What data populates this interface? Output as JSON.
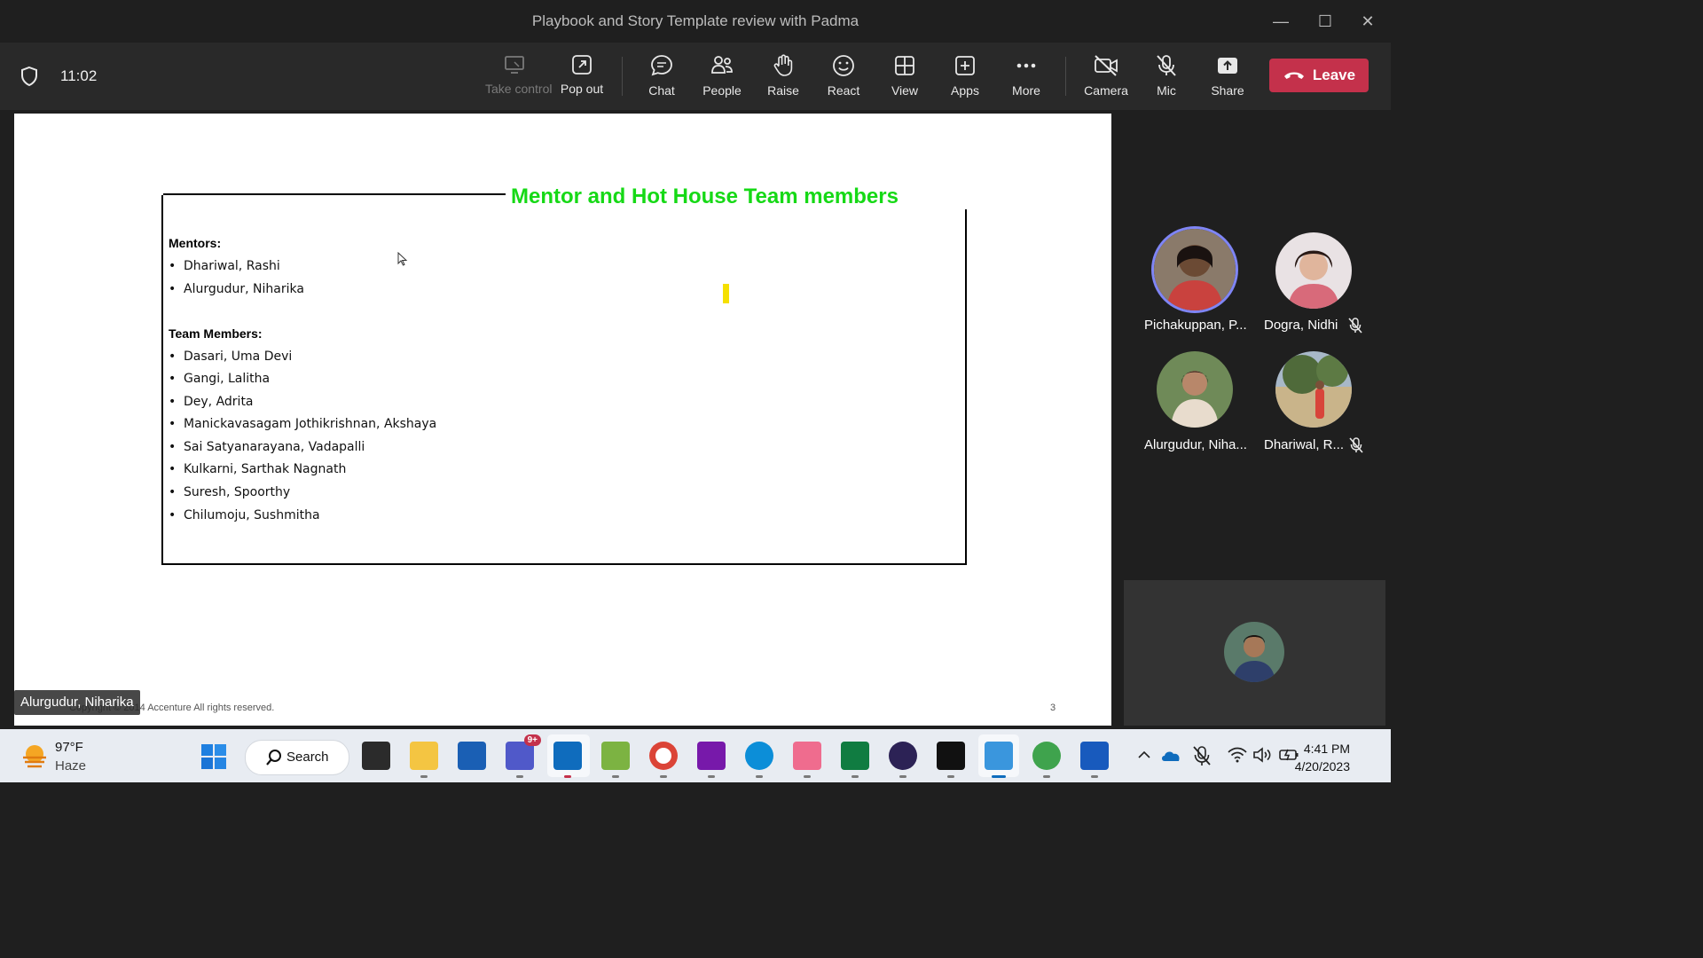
{
  "window": {
    "title": "Playbook and Story Template review with Padma"
  },
  "meeting": {
    "elapsed": "11:02"
  },
  "toolbar": {
    "take_control": "Take control",
    "pop_out": "Pop out",
    "chat": "Chat",
    "people": "People",
    "raise": "Raise",
    "react": "React",
    "view": "View",
    "apps": "Apps",
    "more": "More",
    "camera": "Camera",
    "mic": "Mic",
    "share": "Share",
    "leave": "Leave"
  },
  "slide": {
    "title": "Mentor and Hot House Team members",
    "mentors_heading": "Mentors:",
    "mentors": [
      "Dhariwal, Rashi",
      "Alurgudur, Niharika"
    ],
    "team_heading": "Team Members:",
    "team": [
      "Dasari, Uma Devi",
      "Gangi, Lalitha",
      "Dey, Adrita",
      "Manickavasagam Jothikrishnan, Akshaya",
      "Sai Satyanarayana, Vadapalli",
      "Kulkarni, Sarthak Nagnath",
      "Suresh, Spoorthy",
      "Chilumoju, Sushmitha"
    ],
    "copyright": "Copyright © 2014 Accenture  All rights reserved.",
    "page_number": "3",
    "bullet": "•"
  },
  "active_speaker_label": "Alurgudur, Niharika",
  "participants": [
    {
      "name": "Pichakuppan, P...",
      "muted": false
    },
    {
      "name": "Dogra, Nidhi",
      "muted": true
    },
    {
      "name": "Alurgudur, Niha...",
      "muted": false
    },
    {
      "name": "Dhariwal, R...",
      "muted": true
    }
  ],
  "taskbar": {
    "weather_temp": "97°F",
    "weather_desc": "Haze",
    "search_label": "Search",
    "teams_badge": "9+",
    "time": "4:41 PM",
    "date": "4/20/2023"
  },
  "colors": {
    "accent": "#7f85f5",
    "leave": "#c4314b",
    "slide_title": "#16d916"
  }
}
